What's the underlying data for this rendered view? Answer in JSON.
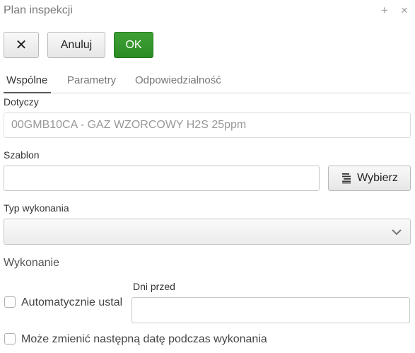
{
  "window": {
    "title": "Plan inspekcji",
    "plus_icon": "+",
    "close_icon": "×"
  },
  "toolbar": {
    "close_symbol": "✕",
    "cancel_label": "Anuluj",
    "ok_label": "OK"
  },
  "tabs": [
    {
      "label": "Wspólne",
      "active": true
    },
    {
      "label": "Parametry",
      "active": false
    },
    {
      "label": "Odpowiedzialność",
      "active": false
    }
  ],
  "form": {
    "dotyczy_label": "Dotyczy",
    "dotyczy_value": "00GMB10CA  - GAZ WZORCOWY H2S 25ppm",
    "szablon_label": "Szablon",
    "szablon_value": "",
    "wybierz_label": "Wybierz",
    "typ_label": "Typ wykonania",
    "typ_value": "",
    "section_wykonanie": "Wykonanie",
    "dni_przed_label": "Dni przed",
    "dni_przed_value": "",
    "auto_label": "Automatycznie ustal",
    "moze_label": "Może zmienić następną datę podczas wykonania"
  },
  "colors": {
    "ok_button": "#2e8f27",
    "active_tab_underline": "#5a5a5a"
  }
}
